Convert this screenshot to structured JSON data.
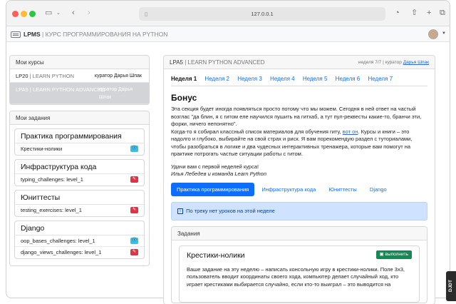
{
  "browser": {
    "url": "127.0.0.1"
  },
  "navbar": {
    "brand": "LPMS",
    "subtitle": "КУРС ПРОГРАММИРОВАНИЯ НА PYTHON"
  },
  "my_courses": {
    "title": "Мои курсы",
    "items": [
      {
        "code": "LP20",
        "sep": "|",
        "name": "LEARN PYTHON",
        "curator": "куратор Дарья Шпак",
        "active": false
      },
      {
        "code": "LPA5",
        "sep": "|",
        "name": "LEARN PYTHON ADVANCED",
        "curator": "куратор Дарья Шпак",
        "active": true
      }
    ]
  },
  "my_tasks": {
    "title": "Мои задания",
    "groups": [
      {
        "title": "Практика программирования",
        "items": [
          {
            "label": "Крестики-нолики",
            "status_icon": "info-icon",
            "status": "info"
          }
        ]
      },
      {
        "title": "Инфраструктура кода",
        "items": [
          {
            "label": "typing_challenges: level_1",
            "status_icon": "edit-icon",
            "status": "danger"
          }
        ]
      },
      {
        "title": "Юниттесты",
        "items": [
          {
            "label": "testing_exercises: level_1",
            "status_icon": "edit-icon",
            "status": "danger"
          }
        ]
      },
      {
        "title": "Django",
        "items": [
          {
            "label": "oop_bases_challenges: level_1",
            "status_icon": "info-icon",
            "status": "info"
          },
          {
            "label": "django_views_challenges: level_1",
            "status_icon": "edit-icon",
            "status": "danger"
          }
        ]
      }
    ]
  },
  "course_panel": {
    "code": "LPA5",
    "sep": "|",
    "name": "LEARN PYTHON ADVANCED",
    "meta_prefix": "неделя 7/7 | куратор",
    "curator": "Дарья Шпак",
    "tabs": [
      "Неделя 1",
      "Неделя 2",
      "Неделя 3",
      "Неделя 4",
      "Неделя 5",
      "Неделя 6",
      "Неделя 7"
    ],
    "section_title": "Бонус",
    "p1": "Эта секция будет иногда появляться просто потому что мы можем. Сегодня в ней ответ на частый возглас \"да блин, я с гитом еле научился пушить на гитхаб, а тут пул-реквесты какие-то, бранчи эти, форки, ничего непонятно\".",
    "p2_before": "Когда-то я собирал классный список материалов для обучения гиту,",
    "p2_link": "вот он",
    "p2_after": ". Курсы и книги – это надолго и глубоко, выбирайте на свой страх и риск. Я вам порекомендую раздел с туториалами, чтобы разобраться в логике и два чудесных интерактивных тренажера, которые вам помогут на практике потрогать частые ситуации работы с гитом.",
    "greeting": "Удачи вам с первой неделей курса!",
    "signature": "Илья Лебедев и команда Learn Python",
    "pills": [
      "Практика программирования",
      "Инфраструктура кода",
      "Юниттесты",
      "Django"
    ],
    "alert": "По треку нет уроков на этой неделе",
    "tasks_title": "Задания",
    "task": {
      "title": "Крестики-нолики",
      "run_label": "выполнить",
      "text": "Ваше задание на эту неделю – написать консольную игру в крестики-нолики. Поле 3х3, пользователь вводит координаты своего хода, компьютер делает случайный ход, кто играет крестиками выбирается случайно, если кто-то выиграл – это выводится на"
    }
  },
  "debug_toolbar": "DJDT"
}
